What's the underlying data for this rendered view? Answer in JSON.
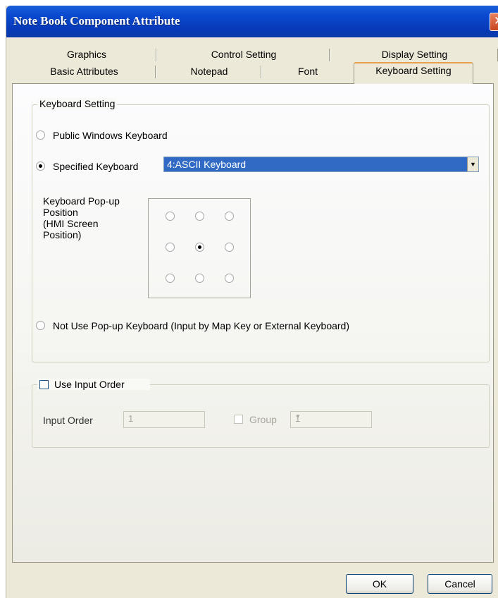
{
  "window": {
    "title": "Note Book Component Attribute",
    "close_glyph": "✕"
  },
  "tabs": {
    "back_row": [
      "Graphics",
      "Control Setting",
      "Display Setting"
    ],
    "front_row": [
      "Basic Attributes",
      "Notepad",
      "Font",
      "Keyboard Setting"
    ],
    "active": "Keyboard Setting"
  },
  "keyboard_setting": {
    "group_label": "Keyboard Setting",
    "public_keyboard_label": "Public Windows Keyboard",
    "public_keyboard_selected": false,
    "specified_keyboard_label": "Specified Keyboard",
    "specified_keyboard_selected": true,
    "keyboard_select_value": "4:ASCII Keyboard",
    "popup_position_label_lines": [
      "Keyboard Pop-up",
      "Position",
      "(HMI Screen",
      "Position)"
    ],
    "popup_position_grid": [
      [
        false,
        false,
        false
      ],
      [
        false,
        true,
        false
      ],
      [
        false,
        false,
        false
      ]
    ],
    "not_use_popup_label": "Not Use Pop-up Keyboard (Input by Map Key or External Keyboard)",
    "not_use_popup_selected": false
  },
  "input_order": {
    "use_input_order_label": "Use Input Order",
    "use_input_order_checked": false,
    "input_order_label": "Input Order",
    "input_order_value": "1",
    "group_label": "Group",
    "group_checked": false,
    "group_value": "1"
  },
  "buttons": {
    "ok": "OK",
    "cancel": "Cancel"
  },
  "icons": {
    "close": "close-icon",
    "dropdown": "chevron-down-icon"
  },
  "colors": {
    "titlebar": "#0a4ad0",
    "selection": "#316ac5",
    "active_tab_accent": "#e8a04a",
    "close_button": "#c8451f"
  }
}
